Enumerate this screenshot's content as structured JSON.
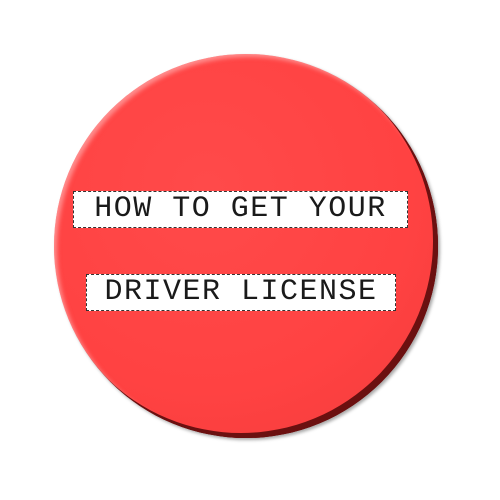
{
  "badge": {
    "color": "#ff4444",
    "line1": "HOW TO GET YOUR",
    "line2": "DRIVER LICENSE"
  }
}
